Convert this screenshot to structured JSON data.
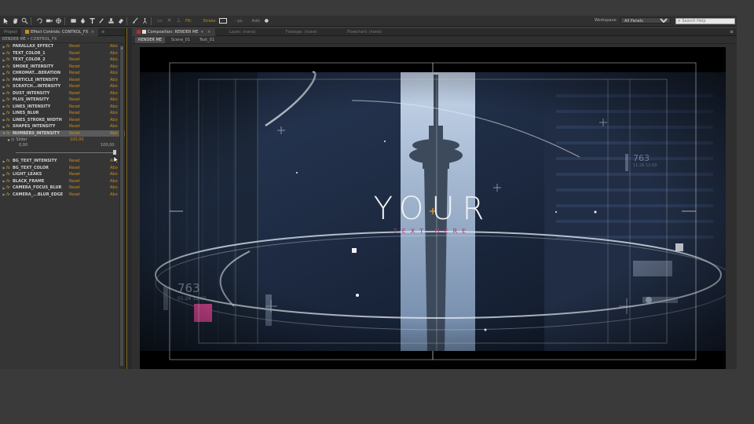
{
  "toolbar": {
    "tools": [
      "selection-tool",
      "hand-tool",
      "zoom-tool",
      "rotate-tool",
      "camera-tool",
      "pan-behind-tool",
      "rectangle-tool",
      "pen-tool",
      "type-tool",
      "brush-tool",
      "clone-stamp-tool",
      "eraser-tool",
      "roto-brush-tool",
      "puppet-tool"
    ],
    "fill_label": "Fill:",
    "stroke_label": "Stroke:",
    "stroke_width": "- px",
    "add_label": "Add:",
    "workspace_label": "Workspace:",
    "workspace_value": "All Panels",
    "search_placeholder": "Search Help"
  },
  "left_panel": {
    "tabs": [
      {
        "label": "Project"
      },
      {
        "label": "Effect Controls: CONTROL_FX"
      }
    ],
    "subheader": "RENDER ME • CONTROL_FX",
    "reset_label": "Reset",
    "about_label": "Abo",
    "effects_top": [
      "PARALLAX_EFFECT",
      "TEXT_COLOR_1",
      "TEXT_COLOR_2",
      "SMOKE_INTENSITY",
      "CHROMAT...BERATION",
      "PARTICLE_INTENSITY",
      "SCRATCH...INTENSITY",
      "DUST_INTENSITY",
      "PLUS_INTENSITY",
      "LINES_INTENSITY",
      "LINES_BLUR",
      "LINES_STROKE_WIDTH",
      "SHAPES_INTENSITY"
    ],
    "selected_effect": "NUMBERS_INTENSITY",
    "slider": {
      "label": "Slider",
      "value": "100,00",
      "range_min": "0,00",
      "range_max": "100,00",
      "level": 1.0
    },
    "effects_bottom": [
      "BG_TEXT_INTENSITY",
      "BG_TEXT_COLOR",
      "LIGHT_LEAKS",
      "BLACK_FRAME",
      "CAMERA_FOCUS_BLUR",
      "CAMERA_...BLUR_EDGE"
    ]
  },
  "comp_panel": {
    "tabs": [
      {
        "label": "Composition: RENDER ME"
      },
      {
        "label": "Layer: (none)"
      },
      {
        "label": "Footage: (none)"
      },
      {
        "label": "Flowchart: (none)"
      }
    ],
    "breadcrumbs": [
      "RENDER ME",
      "Scene_01",
      "Text_01"
    ]
  },
  "composition": {
    "title_text": "YOUR",
    "subtitle_text": "TEXT HERE",
    "number_left": "763",
    "number_left_small": "01:26 12:00",
    "number_right": "763",
    "number_right_small": "11:26 12:00",
    "colors": {
      "subtitle": "#b0347c",
      "pink_square": "#e04a9a",
      "sky": "#9fb8d6",
      "background": "#1b2638"
    }
  }
}
